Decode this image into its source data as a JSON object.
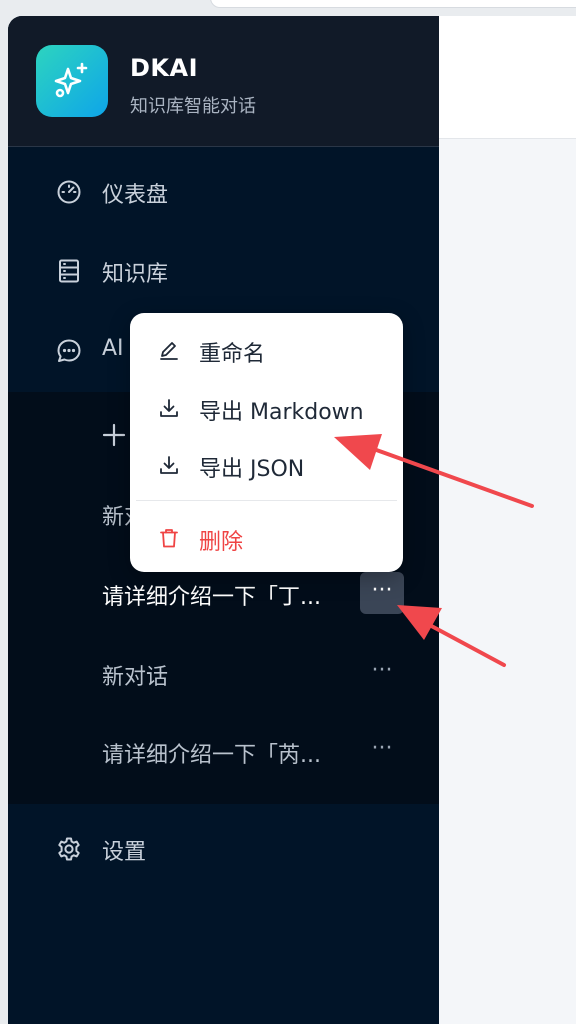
{
  "brand": {
    "name": "DKAI",
    "subtitle": "知识库智能对话"
  },
  "nav": {
    "dashboard": "仪表盘",
    "knowledge": "知识库",
    "ai_chat_partial": "AI",
    "settings": "设置"
  },
  "chat": {
    "new_partial": "新对",
    "conversations": [
      {
        "title": "请详细介绍一下「丁...",
        "active": true
      },
      {
        "title": "新对话",
        "active": false
      },
      {
        "title": "请详细介绍一下「芮...",
        "active": false
      }
    ],
    "more_label": "···"
  },
  "context_menu": {
    "rename": "重命名",
    "export_markdown": "导出 Markdown",
    "export_json": "导出 JSON",
    "delete": "删除"
  },
  "colors": {
    "sidebar_bg": "#011428",
    "brand_bg": "#111a28",
    "accent_start": "#2dd4bf",
    "accent_end": "#0ea5e9",
    "danger": "#ef4444",
    "annotation_arrow": "#f0484d"
  }
}
